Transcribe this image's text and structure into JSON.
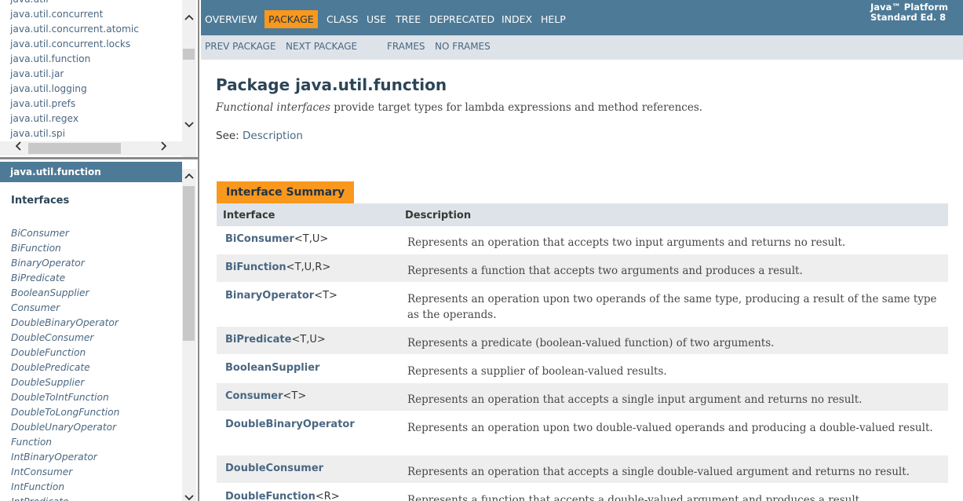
{
  "packages_frame": {
    "items": [
      "java.util",
      "java.util.concurrent",
      "java.util.concurrent.atomic",
      "java.util.concurrent.locks",
      "java.util.function",
      "java.util.jar",
      "java.util.logging",
      "java.util.prefs",
      "java.util.regex",
      "java.util.spi"
    ],
    "scroll_up": "⌃",
    "scroll_down": "⌄",
    "scroll_left": "‹",
    "scroll_right": "›"
  },
  "classes_frame": {
    "package_name": "java.util.function",
    "heading": "Interfaces",
    "items": [
      "BiConsumer",
      "BiFunction",
      "BinaryOperator",
      "BiPredicate",
      "BooleanSupplier",
      "Consumer",
      "DoubleBinaryOperator",
      "DoubleConsumer",
      "DoubleFunction",
      "DoublePredicate",
      "DoubleSupplier",
      "DoubleToIntFunction",
      "DoubleToLongFunction",
      "DoubleUnaryOperator",
      "Function",
      "IntBinaryOperator",
      "IntConsumer",
      "IntFunction",
      "IntPredicate"
    ]
  },
  "topnav": {
    "items": [
      "OVERVIEW",
      "PACKAGE",
      "CLASS",
      "USE",
      "TREE",
      "DEPRECATED",
      "INDEX",
      "HELP"
    ],
    "active": "PACKAGE",
    "platform_line1": "Java™ Platform",
    "platform_line2": "Standard Ed. 8"
  },
  "subnav": {
    "prev": "PREV PACKAGE",
    "next": "NEXT PACKAGE",
    "frames": "FRAMES",
    "no_frames": "NO FRAMES"
  },
  "main": {
    "title": "Package java.util.function",
    "desc_em": "Functional interfaces",
    "desc_rest": " provide target types for lambda expressions and method references.",
    "see_label": "See: ",
    "see_link": "Description"
  },
  "summary": {
    "tab": "Interface Summary",
    "col_interface": "Interface",
    "col_description": "Description",
    "rows": [
      {
        "name": "BiConsumer",
        "generics": "<T,U>",
        "desc": "Represents an operation that accepts two input arguments and returns no result."
      },
      {
        "name": "BiFunction",
        "generics": "<T,U,R>",
        "desc": "Represents a function that accepts two arguments and produces a result."
      },
      {
        "name": "BinaryOperator",
        "generics": "<T>",
        "desc": "Represents an operation upon two operands of the same type, producing a result of the same type as the operands."
      },
      {
        "name": "BiPredicate",
        "generics": "<T,U>",
        "desc": "Represents a predicate (boolean-valued function) of two arguments."
      },
      {
        "name": "BooleanSupplier",
        "generics": "",
        "desc": "Represents a supplier of boolean-valued results."
      },
      {
        "name": "Consumer",
        "generics": "<T>",
        "desc": "Represents an operation that accepts a single input argument and returns no result."
      },
      {
        "name": "DoubleBinaryOperator",
        "generics": "",
        "desc": "Represents an operation upon two double-valued operands and producing a double-valued result."
      },
      {
        "name": "DoubleConsumer",
        "generics": "",
        "desc": "Represents an operation that accepts a single double-valued argument and returns no result."
      },
      {
        "name": "DoubleFunction",
        "generics": "<R>",
        "desc": "Represents a function that accepts a double-valued argument and produces a result."
      }
    ]
  }
}
